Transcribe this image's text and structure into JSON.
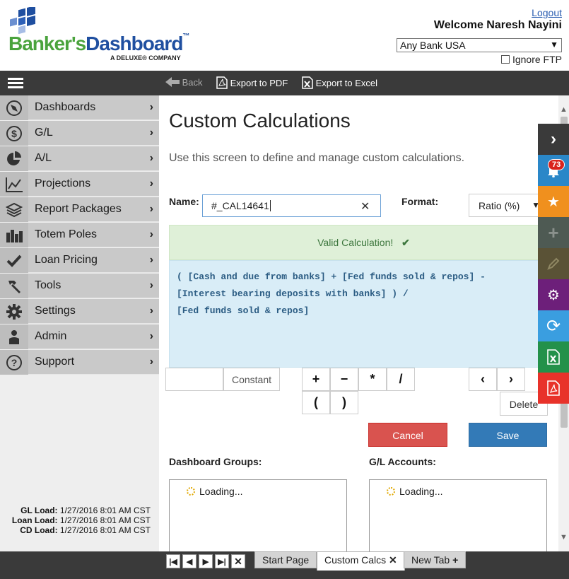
{
  "header": {
    "logo": {
      "brand_green": "Banker's",
      "brand_blue": "Dashboard",
      "trademark": "™",
      "sub": "A DELUXE® COMPANY"
    },
    "logout": "Logout",
    "welcome": "Welcome  Naresh Nayini",
    "bank_select": "Any Bank USA",
    "ignore_ftp": "Ignore FTP"
  },
  "toolbar": {
    "back": "Back",
    "export_pdf": "Export to PDF",
    "export_excel": "Export to Excel"
  },
  "sidebar": {
    "items": [
      {
        "label": "Dashboards",
        "icon": "compass-icon"
      },
      {
        "label": "G/L",
        "icon": "dollar-icon"
      },
      {
        "label": "A/L",
        "icon": "pie-chart-icon"
      },
      {
        "label": "Projections",
        "icon": "line-chart-icon"
      },
      {
        "label": "Report Packages",
        "icon": "layers-icon"
      },
      {
        "label": "Totem Poles",
        "icon": "bar-chart-icon"
      },
      {
        "label": "Loan Pricing",
        "icon": "checkmark-icon"
      },
      {
        "label": "Tools",
        "icon": "hammer-icon"
      },
      {
        "label": "Settings",
        "icon": "gear-icon"
      },
      {
        "label": "Admin",
        "icon": "person-icon"
      },
      {
        "label": "Support",
        "icon": "question-icon"
      }
    ],
    "loads": {
      "gl_label": "GL Load:",
      "gl_value": "1/27/2016 8:01 AM CST",
      "loan_label": "Loan Load:",
      "loan_value": "1/27/2016 8:01 AM CST",
      "cd_label": "CD Load:",
      "cd_value": "1/27/2016 8:01 AM CST"
    }
  },
  "main": {
    "title": "Custom Calculations",
    "description": "Use this screen to define and manage custom calculations.",
    "name_label": "Name:",
    "name_value": "#_CAL14641",
    "format_label": "Format:",
    "format_value": "Ratio (%)",
    "valid_message": "Valid Calculation!",
    "formula_lines": [
      "( [Cash and due from banks] + [Fed funds sold & repos] -",
      "[Interest bearing deposits with banks] ) /",
      "[Fed funds sold & repos]"
    ],
    "constant_label": "Constant",
    "operators": {
      "plus": "+",
      "minus": "−",
      "multiply": "*",
      "divide": "/",
      "open_paren": "(",
      "close_paren": ")",
      "left": "‹",
      "right": "›"
    },
    "delete_label": "Delete",
    "cancel_label": "Cancel",
    "save_label": "Save",
    "dashboard_groups_label": "Dashboard Groups:",
    "gl_accounts_label": "G/L Accounts:",
    "loading_text": "Loading..."
  },
  "rail": {
    "notification_count": "73",
    "colors": {
      "expand": "#3a3a3a",
      "notifications": "#2a87c8",
      "favorites": "#f0901e",
      "add": "#4e5a53",
      "edit": "#5a5236",
      "settings": "#6d1f7a",
      "refresh": "#3a9ee0",
      "excel": "#23914a",
      "pdf": "#e8322a"
    }
  },
  "bottom": {
    "tabs": [
      {
        "label": "Start Page"
      },
      {
        "label": "Custom Calcs",
        "active": true
      },
      {
        "label": "New Tab"
      }
    ]
  }
}
